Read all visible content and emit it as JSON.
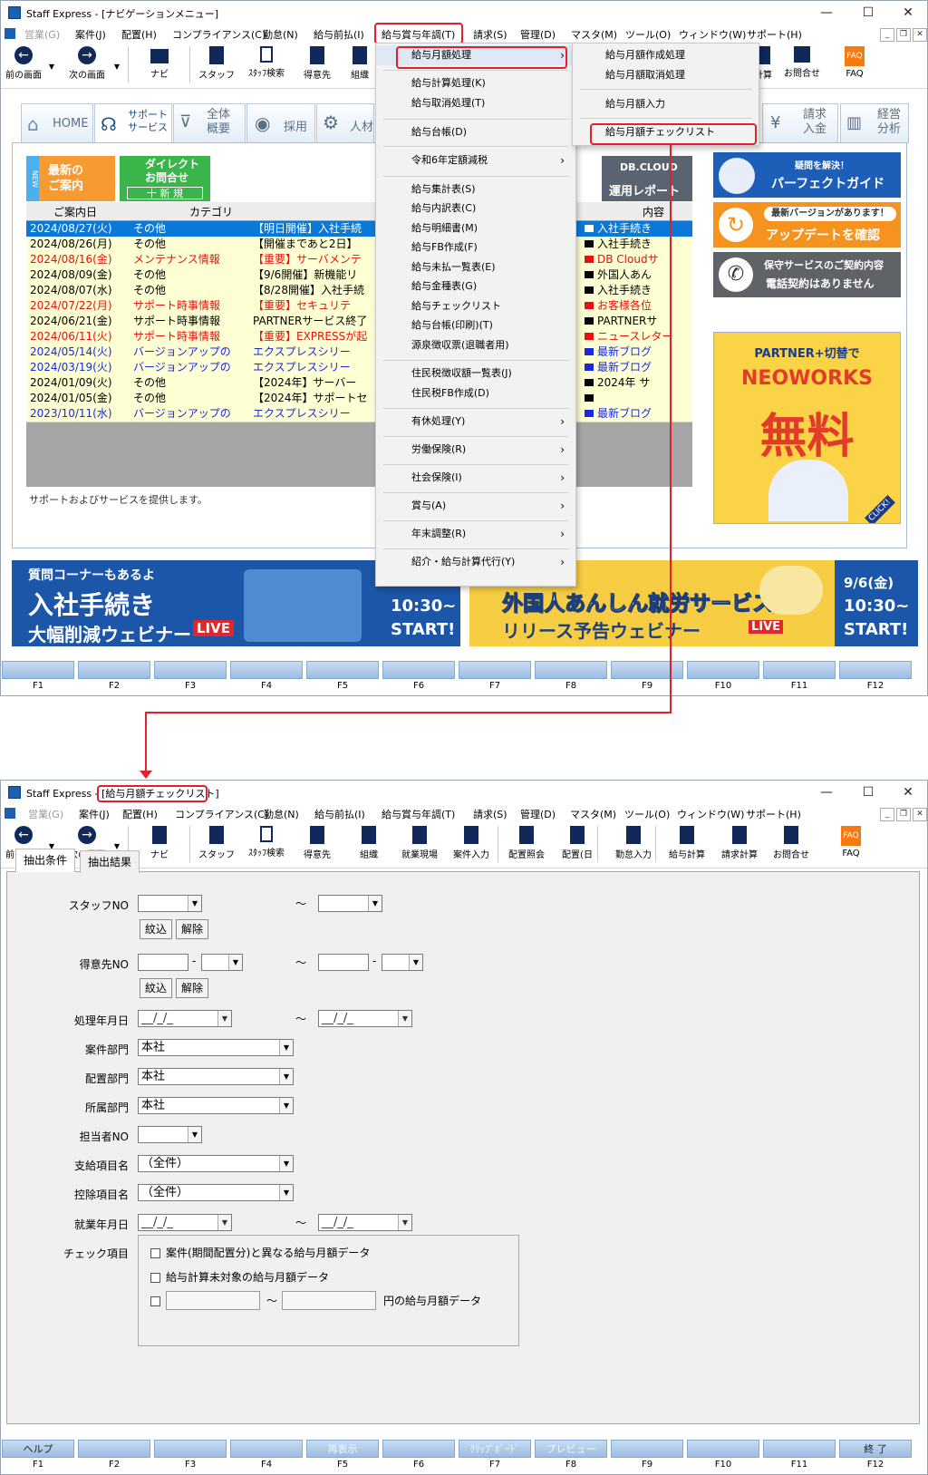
{
  "window1": {
    "title": "Staff Express - [ナビゲーションメニュー]",
    "menus": [
      "営業(G)",
      "案件(J)",
      "配置(H)",
      "コンプライアンス(C)",
      "勤怠(N)",
      "給与前払(I)",
      "給与賞与年調(T)",
      "請求(S)",
      "管理(D)",
      "マスタ(M)",
      "ツール(O)",
      "ウィンドウ(W)",
      "サポート(H)"
    ],
    "toolbar": [
      "前の画面",
      "次の画面",
      "ナビ",
      "スタッフ",
      "ｽﾀｯﾌ検索",
      "得意先",
      "組織",
      "計算",
      "お問合せ",
      "FAQ"
    ],
    "nav_tabs": [
      "HOME",
      "サポート\nサービス",
      "全体\n概要",
      "採用",
      "人材",
      "請求\n入金",
      "経営\n分析"
    ],
    "tiles": {
      "news": "最新の\nご案内",
      "new_badge": "NEW",
      "direct": "ダイレクト\nお問合せ",
      "direct_new": "十 新 規",
      "dbcloud_logo": "DB.CLOUD",
      "dbcloud_report": "運用レポート"
    },
    "news_headers": [
      "ご案内日",
      "カテゴリ",
      "",
      "内容"
    ],
    "news_rows": [
      {
        "date": "2024/08/27(火)",
        "cat": "その他",
        "title": "【明日開催】入社手続",
        "content": "入社手続き",
        "style": "selected"
      },
      {
        "date": "2024/08/26(月)",
        "cat": "その他",
        "title": "【開催まであと2日】",
        "content": "入社手続き",
        "style": "normal"
      },
      {
        "date": "2024/08/16(金)",
        "cat": "メンテナンス情報",
        "title": "【重要】サーバメンテ",
        "content": "DB Cloudサ",
        "style": "red"
      },
      {
        "date": "2024/08/09(金)",
        "cat": "その他",
        "title": "【9/6開催】新機能リ",
        "content": "外国人あん",
        "style": "normal"
      },
      {
        "date": "2024/08/07(水)",
        "cat": "その他",
        "title": "【8/28開催】入社手続",
        "content": "入社手続き",
        "style": "normal"
      },
      {
        "date": "2024/07/22(月)",
        "cat": "サポート時事情報",
        "title": "【重要】セキュリテ",
        "content": "お客様各位",
        "style": "red"
      },
      {
        "date": "2024/06/21(金)",
        "cat": "サポート時事情報",
        "title": "PARTNERサービス終了",
        "content": "PARTNERサ",
        "style": "normal"
      },
      {
        "date": "2024/06/11(火)",
        "cat": "サポート時事情報",
        "title": "【重要】EXPRESSが起",
        "content": "ニュースレター",
        "style": "red"
      },
      {
        "date": "2024/05/14(火)",
        "cat": "バージョンアップの",
        "title": "エクスプレスシリー",
        "content": "最新ブログ",
        "style": "blue"
      },
      {
        "date": "2024/03/19(火)",
        "cat": "バージョンアップの",
        "title": "エクスプレスシリー",
        "content": "最新ブログ",
        "style": "blue"
      },
      {
        "date": "2024/01/09(火)",
        "cat": "その他",
        "title": "【2024年】サーバー",
        "content": "2024年 サ",
        "style": "normal"
      },
      {
        "date": "2024/01/05(金)",
        "cat": "その他",
        "title": "【2024年】サポートセ",
        "content": "",
        "style": "normal"
      },
      {
        "date": "2023/10/11(水)",
        "cat": "バージョンアップの",
        "title": "エクスプレスシリー",
        "content": "最新ブログ",
        "style": "blue"
      }
    ],
    "footer_text": "サポートおよびサービスを提供します。",
    "right_banners": {
      "guide_small": "疑問を解決！",
      "guide": "パーフェクトガイド",
      "update_small": "最新バージョンがあります！",
      "update": "アップデートを確認",
      "contract_small": "保守サービスのご契約内容",
      "contract": "電話契約はありません",
      "neo_small": "PARTNER+切替で",
      "neo_brand": "NEOWORKS",
      "neo_free": "無料",
      "neo_click": "CLICK!"
    },
    "bottom_banners": {
      "left_small": "質問コーナーもあるよ",
      "left_big": "入社手続き",
      "left_big2": "大幅削減ウェビナー",
      "live": "LIVE",
      "left_time": "10:30~",
      "left_start": "START!",
      "right_big": "外国人あんしん就労サービス",
      "right_big2": "リリース予告ウェビナー",
      "right_date": "9/6(金)",
      "right_time": "10:30~",
      "right_start": "START!"
    },
    "dropdown": {
      "items": [
        "給与月額処理",
        "給与計算処理(K)",
        "給与取消処理(T)",
        "給与台帳(D)",
        "令和6年定額減税",
        "給与集計表(S)",
        "給与内訳表(C)",
        "給与明細書(M)",
        "給与FB作成(F)",
        "給与未払一覧表(E)",
        "給与金種表(G)",
        "給与チェックリスト",
        "給与台帳(印刷)(T)",
        "源泉徴収票(退職者用)",
        "住民税徴収額一覧表(J)",
        "住民税FB作成(D)",
        "有休処理(Y)",
        "労働保険(R)",
        "社会保険(I)",
        "賞与(A)",
        "年末調整(R)",
        "紹介・給与計算代行(Y)"
      ]
    },
    "submenu": [
      "給与月額作成処理",
      "給与月額取消処理",
      "給与月額入力",
      "給与月額チェックリスト"
    ],
    "fkeys": [
      "F1",
      "F2",
      "F3",
      "F4",
      "F5",
      "F6",
      "F7",
      "F8",
      "F9",
      "F10",
      "F11",
      "F12"
    ]
  },
  "window2": {
    "title_prefix": "Staff Express - ",
    "title_doc": "[給与月額チェックリスト]",
    "menus": [
      "営業(G)",
      "案件(J)",
      "配置(H)",
      "コンプライアンス(C)",
      "勤怠(N)",
      "給与前払(I)",
      "給与賞与年調(T)",
      "請求(S)",
      "管理(D)",
      "マスタ(M)",
      "ツール(O)",
      "ウィンドウ(W)",
      "サポート(H)"
    ],
    "toolbar": [
      "前の画面",
      "次の画面",
      "ナビ",
      "スタッフ",
      "ｽﾀｯﾌ検索",
      "得意先",
      "組織",
      "就業現場",
      "案件入力",
      "配置照会",
      "配置(日",
      "勤怠入力",
      "給与計算",
      "請求計算",
      "お問合せ",
      "FAQ"
    ],
    "tabs": [
      "抽出条件",
      "抽出結果"
    ],
    "form": {
      "staff_no": "スタッフNO",
      "narrow": "紋込",
      "clear": "解除",
      "client_no": "得意先NO",
      "process_date": "処理年月日",
      "date_placeholder": "__/_/_",
      "case_dept": "案件部門",
      "case_dept_val": "本社",
      "assign_dept": "配置部門",
      "assign_dept_val": "本社",
      "belong_dept": "所属部門",
      "belong_dept_val": "本社",
      "staff_in_charge": "担当者NO",
      "pay_item": "支給項目名",
      "pay_item_val": "（全件）",
      "deduct_item": "控除項目名",
      "deduct_item_val": "（全件）",
      "work_date": "就業年月日",
      "tilde": "～",
      "dash": "-",
      "check_items": "チェック項目",
      "check1": "案件(期間配置分)と異なる給与月額データ",
      "check2": "給与計算未対象の給与月額データ",
      "check3_suffix": "円の給与月額データ"
    },
    "fkeys": [
      "F1",
      "F2",
      "F3",
      "F4",
      "F5",
      "F6",
      "F7",
      "F8",
      "F9",
      "F10",
      "F11",
      "F12"
    ],
    "fkey_labels": [
      "ヘルプ",
      "",
      "",
      "",
      "再表示",
      "",
      "ｸﾘｯﾌﾟﾎﾞｰﾄﾞ",
      "プレビュー",
      "",
      "",
      "",
      "終 了"
    ]
  },
  "colors": {
    "highlight": "#e0202a",
    "navy": "#10285a",
    "selected_row": "#0a78d7",
    "news_bg": "#ffffd4"
  }
}
